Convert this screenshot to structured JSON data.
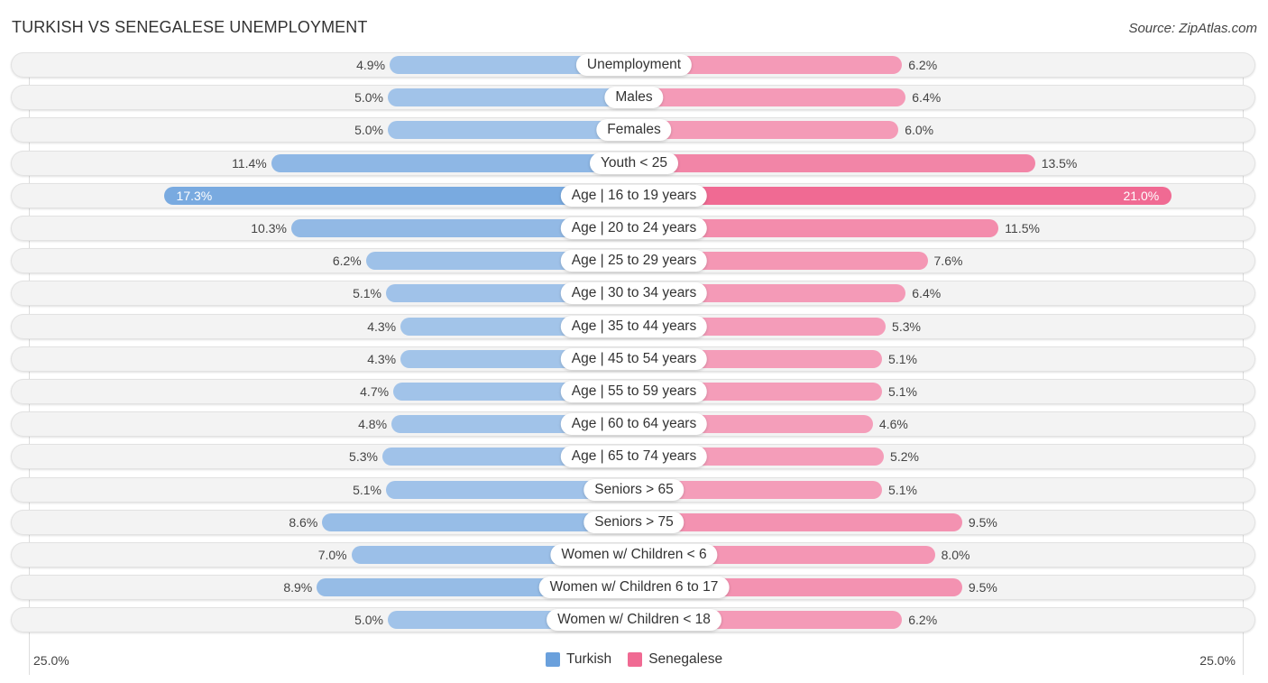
{
  "header": {
    "title": "TURKISH VS SENEGALESE UNEMPLOYMENT",
    "source": "Source: ZipAtlas.com"
  },
  "colors": {
    "turkish": "#6aa0dc",
    "turkish_light": "#a9c8eb",
    "senegalese": "#f06a93",
    "senegalese_light": "#f5a5bf"
  },
  "chart_data": {
    "type": "bar",
    "orientation": "horizontal-diverging",
    "title": "TURKISH VS SENEGALESE UNEMPLOYMENT",
    "xlabel": "",
    "ylabel": "",
    "xlim": [
      0,
      25.0
    ],
    "axis_labels": {
      "left": "25.0%",
      "right": "25.0%"
    },
    "legend_position": "bottom-center",
    "categories": [
      "Unemployment",
      "Males",
      "Females",
      "Youth < 25",
      "Age | 16 to 19 years",
      "Age | 20 to 24 years",
      "Age | 25 to 29 years",
      "Age | 30 to 34 years",
      "Age | 35 to 44 years",
      "Age | 45 to 54 years",
      "Age | 55 to 59 years",
      "Age | 60 to 64 years",
      "Age | 65 to 74 years",
      "Seniors > 65",
      "Seniors > 75",
      "Women w/ Children < 6",
      "Women w/ Children 6 to 17",
      "Women w/ Children < 18"
    ],
    "series": [
      {
        "name": "Turkish",
        "side": "left",
        "values": [
          4.9,
          5.0,
          5.0,
          11.4,
          17.3,
          10.3,
          6.2,
          5.1,
          4.3,
          4.3,
          4.7,
          4.8,
          5.3,
          5.1,
          8.6,
          7.0,
          8.9,
          5.0
        ],
        "labels": [
          "4.9%",
          "5.0%",
          "5.0%",
          "11.4%",
          "17.3%",
          "10.3%",
          "6.2%",
          "5.1%",
          "4.3%",
          "4.3%",
          "4.7%",
          "4.8%",
          "5.3%",
          "5.1%",
          "8.6%",
          "7.0%",
          "8.9%",
          "5.0%"
        ]
      },
      {
        "name": "Senegalese",
        "side": "right",
        "values": [
          6.2,
          6.4,
          6.0,
          13.5,
          21.0,
          11.5,
          7.6,
          6.4,
          5.3,
          5.1,
          5.1,
          4.6,
          5.2,
          5.1,
          9.5,
          8.0,
          9.5,
          6.2
        ],
        "labels": [
          "6.2%",
          "6.4%",
          "6.0%",
          "13.5%",
          "21.0%",
          "11.5%",
          "7.6%",
          "6.4%",
          "5.3%",
          "5.1%",
          "5.1%",
          "4.6%",
          "5.2%",
          "5.1%",
          "9.5%",
          "8.0%",
          "9.5%",
          "6.2%"
        ]
      }
    ]
  },
  "legend": [
    {
      "label": "Turkish"
    },
    {
      "label": "Senegalese"
    }
  ]
}
